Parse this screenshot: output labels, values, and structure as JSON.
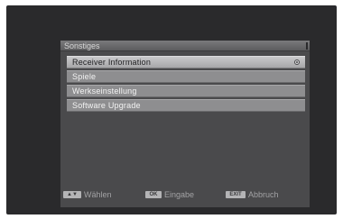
{
  "menu": {
    "title": "Sonstiges",
    "items": [
      {
        "label": "Receiver Information",
        "selected": true
      },
      {
        "label": "Spiele",
        "selected": false
      },
      {
        "label": "Werkseinstellung",
        "selected": false
      },
      {
        "label": "Software Upgrade",
        "selected": false
      }
    ]
  },
  "footer": {
    "select_key": "▲▼",
    "select_label": "Wählen",
    "ok_key": "OK",
    "ok_label": "Eingabe",
    "exit_key": "EXIT",
    "exit_label": "Abbruch"
  },
  "colors": {
    "background": "#2a2a2c",
    "panel": "#4a4a4c",
    "item": "#8e8e90",
    "selected_item": "#b8b8ba"
  }
}
